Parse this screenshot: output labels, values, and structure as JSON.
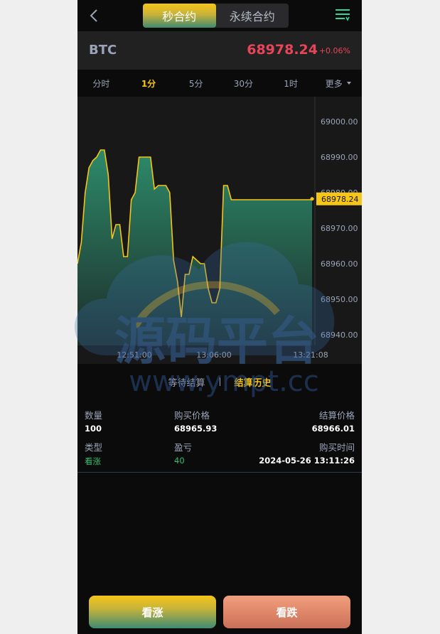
{
  "header": {
    "tabs": [
      {
        "label": "秒合约",
        "active": true
      },
      {
        "label": "永续合约",
        "active": false
      }
    ]
  },
  "ticker": {
    "symbol": "BTC",
    "price": "68978.24",
    "change": "+0.06%",
    "color": "#e8455a"
  },
  "intervals": [
    {
      "label": "分时",
      "active": false
    },
    {
      "label": "1分",
      "active": true
    },
    {
      "label": "5分",
      "active": false
    },
    {
      "label": "30分",
      "active": false
    },
    {
      "label": "1时",
      "active": false
    },
    {
      "label": "更多",
      "active": false,
      "dropdown": true
    }
  ],
  "chart_data": {
    "type": "area",
    "y_ticks": [
      "69000.00",
      "68990.00",
      "68980.00",
      "68970.00",
      "68960.00",
      "68950.00",
      "68940.00"
    ],
    "ylim": [
      68937,
      69007
    ],
    "x_ticks": [
      {
        "label": "12:51:00",
        "pos": 0.2
      },
      {
        "label": "13:06:00",
        "pos": 0.48
      },
      {
        "label": "13:21:08",
        "pos": 0.82
      }
    ],
    "values": [
      68960,
      68966,
      68980,
      68987,
      68989,
      68990,
      68992,
      68992,
      68985,
      68967,
      68971,
      68971,
      68962,
      68962,
      68978,
      68980,
      68990,
      68990,
      68990,
      68990,
      68981,
      68982,
      68982,
      68982,
      68980,
      68961,
      68955,
      68945,
      68957,
      68957,
      68962,
      68961,
      68960,
      68960,
      68953,
      68949,
      68949,
      68953,
      68982,
      68982,
      68978,
      68978,
      68978,
      68978,
      68978,
      68978,
      68978,
      68978,
      68978,
      68978,
      68978,
      68978,
      68978,
      68978,
      68978,
      68978,
      68978,
      68978,
      68978,
      68978,
      68978,
      68978
    ],
    "current": "68978.24",
    "line_color": "#f5c518",
    "fill_top": "#2d8a6a",
    "fill_bottom": "#1d2d2a"
  },
  "history_tabs": [
    {
      "label": "等待结算",
      "active": false
    },
    {
      "label": "结算历史",
      "active": true
    }
  ],
  "record": {
    "qty_label": "数量",
    "qty": "100",
    "buy_price_label": "购买价格",
    "buy_price": "68965.93",
    "settle_price_label": "结算价格",
    "settle_price": "68966.01",
    "type_label": "类型",
    "type": "看涨",
    "pnl_label": "盈亏",
    "pnl": "40",
    "buy_time_label": "购买时间",
    "buy_time": "2024-05-26 13:11:26"
  },
  "actions": {
    "up_label": "看涨",
    "down_label": "看跌"
  },
  "watermark": {
    "title": "源码平台",
    "url": "www.ympt.cc"
  }
}
